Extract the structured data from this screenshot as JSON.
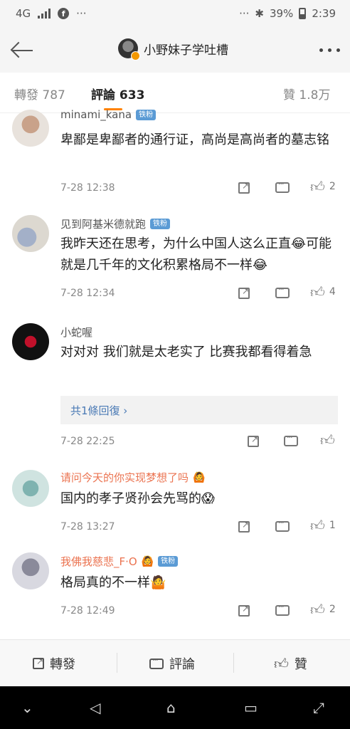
{
  "status_bar": {
    "network": "4G",
    "battery_percent": "39%",
    "time": "2:39",
    "ellipsis": "···"
  },
  "header": {
    "title": "小野妹子学吐槽"
  },
  "tabs": [
    {
      "label": "轉發 787"
    },
    {
      "label": "評論 633"
    },
    {
      "label": "贊 1.8万"
    }
  ],
  "comments": [
    {
      "username": "minami_kana",
      "badge": "铁粉",
      "text": "卑鄙是卑鄙者的通行证，高尚是高尚者的墓志铭",
      "time": "7-28 12:38",
      "likes": "2"
    },
    {
      "username": "见到阿基米德就跑",
      "badge": "铁粉",
      "text": "我昨天还在思考，为什么中国人这么正直😂可能就是几千年的文化积累格局不一样😂",
      "time": "7-28 12:34",
      "likes": "4"
    },
    {
      "username": "小蛇喔",
      "badge": "",
      "text": "对对对 我们就是太老实了 比赛我都看得着急",
      "time": "7-28 22:25",
      "likes": "",
      "reply_link": "共1條回復 ›"
    },
    {
      "username": "请问今天的你实现梦想了吗",
      "badge_emoji": "🙆",
      "text": "国内的孝子贤孙会先骂的😱",
      "time": "7-28 13:27",
      "likes": "1"
    },
    {
      "username": "我佛我慈悲_F·O",
      "badge_emoji": "🙆",
      "badge": "铁粉",
      "text": "格局真的不一样🤷",
      "time": "7-28 12:49",
      "likes": "2"
    }
  ],
  "bottom_bar": {
    "share": "轉發",
    "comment": "評論",
    "like": "贊"
  },
  "colors": {
    "accent": "#ff8200",
    "badge": "#5b9bd5",
    "reply_link": "#4a7ab5",
    "orange_name": "#eb7350"
  }
}
